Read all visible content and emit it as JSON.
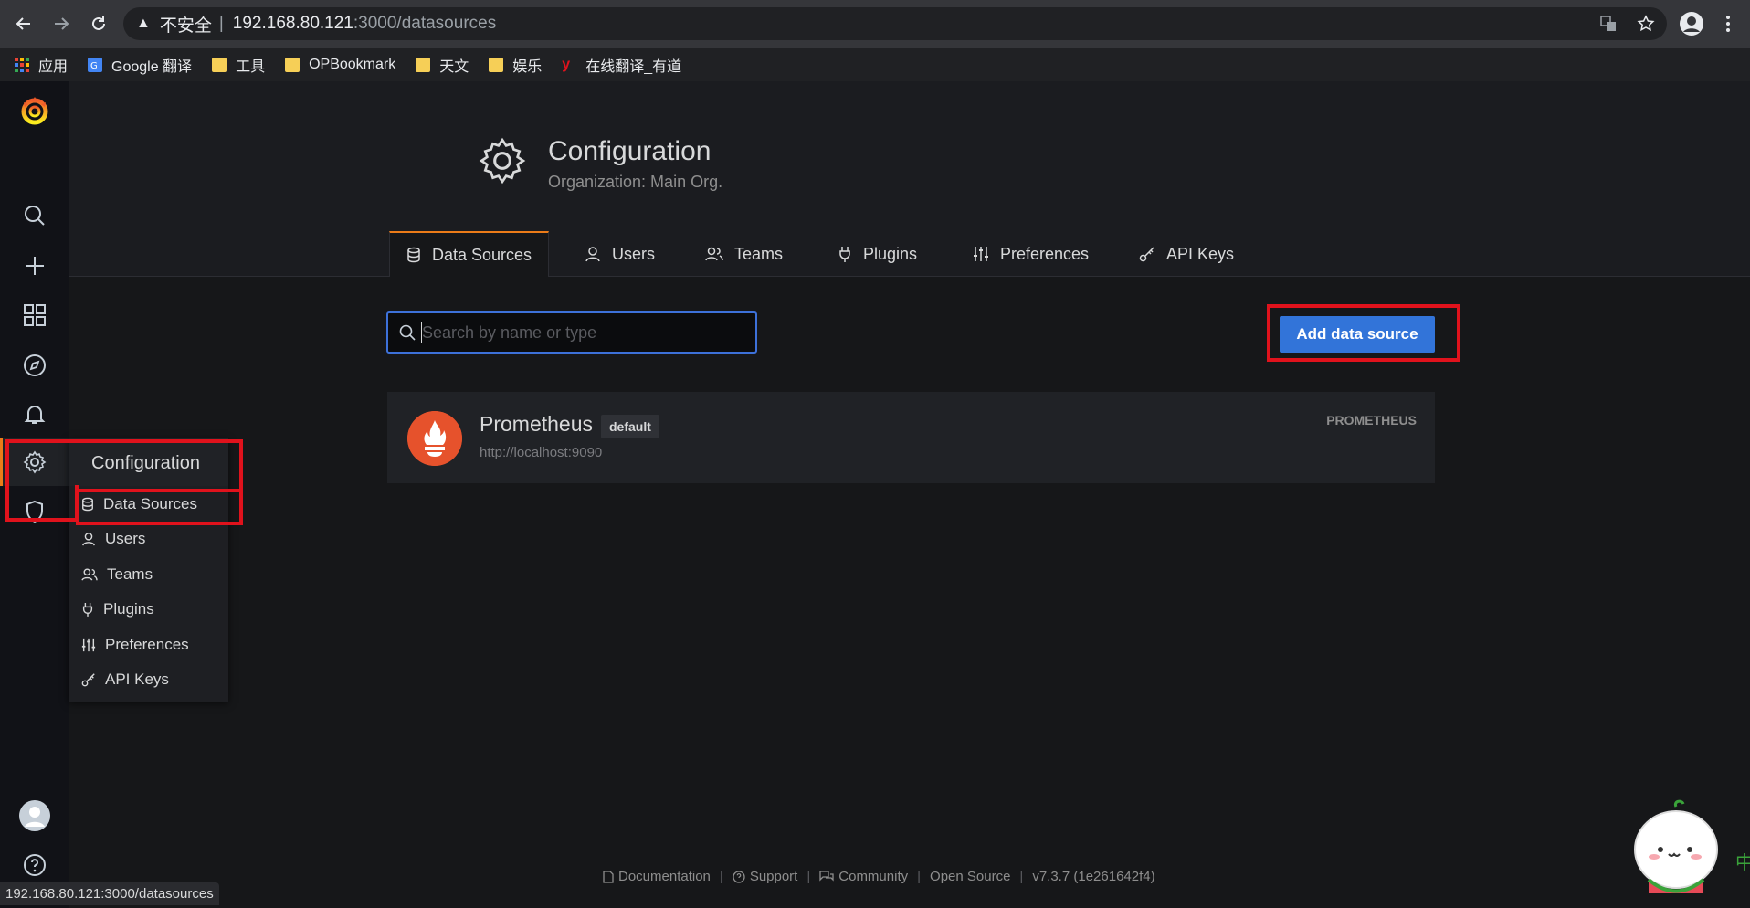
{
  "browser": {
    "omnibox": {
      "warning_icon": "alert-triangle-icon",
      "insecure_label": "不安全",
      "separator": "|",
      "host": "192.168.80.121",
      "path": ":3000/datasources"
    },
    "bookmarks": [
      {
        "label": "应用",
        "icon": "apps-grid-icon"
      },
      {
        "label": "Google 翻译",
        "icon": "google-translate-icon"
      },
      {
        "label": "工具",
        "icon": "folder-icon"
      },
      {
        "label": "OPBookmark",
        "icon": "folder-icon"
      },
      {
        "label": "天文",
        "icon": "folder-icon"
      },
      {
        "label": "娱乐",
        "icon": "folder-icon"
      },
      {
        "label": "在线翻译_有道",
        "icon": "youdao-icon"
      }
    ],
    "status_url": "192.168.80.121:3000/datasources"
  },
  "header": {
    "title": "Configuration",
    "subtitle": "Organization: Main Org."
  },
  "tabs": [
    {
      "label": "Data Sources",
      "icon": "database-icon",
      "active": true
    },
    {
      "label": "Users",
      "icon": "user-icon"
    },
    {
      "label": "Teams",
      "icon": "users-icon"
    },
    {
      "label": "Plugins",
      "icon": "plug-icon"
    },
    {
      "label": "Preferences",
      "icon": "sliders-icon"
    },
    {
      "label": "API Keys",
      "icon": "key-icon"
    }
  ],
  "search": {
    "placeholder": "Search by name or type"
  },
  "add_button": {
    "label": "Add data source"
  },
  "datasource": {
    "name": "Prometheus",
    "badge": "default",
    "url": "http://localhost:9090",
    "type": "PROMETHEUS"
  },
  "hover_menu": {
    "title": "Configuration",
    "items": [
      "Data Sources",
      "Users",
      "Teams",
      "Plugins",
      "Preferences",
      "API Keys"
    ]
  },
  "footer": {
    "documentation": "Documentation",
    "support": "Support",
    "community": "Community",
    "open_source": "Open Source",
    "version": "v7.3.7 (1e261642f4)",
    "separator": "|"
  },
  "colors": {
    "accent": "#eb7b18",
    "primary_button": "#3274d9",
    "highlight_box": "#e0121c",
    "prometheus": "#e6522c"
  },
  "mascot_char": "中"
}
